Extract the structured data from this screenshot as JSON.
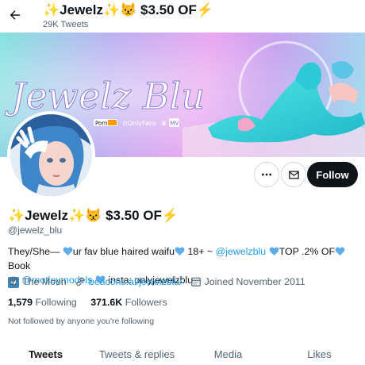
{
  "header": {
    "display_name": "✨Jewelz✨😾 $3.50 OF⚡",
    "tweet_count": "29K Tweets"
  },
  "banner": {
    "title_text": "Jewelz Blu",
    "badges": [
      "Pornhub",
      "OnlyFans",
      "ManyVids"
    ]
  },
  "actions": {
    "follow_label": "Follow"
  },
  "profile": {
    "display_name": "✨Jewelz✨😾 $3.50 OF⚡",
    "handle": "@jewelz_blu",
    "bio": {
      "p1": "They/She— ",
      "p2": "ur fav blue haired waifu",
      "p3": " 18+ ~ ",
      "mention1": "@jewelzblu",
      "p4": "TOP .2% OF",
      "p5": "Book",
      "mention2": "@motleymodels",
      "p6": " insta: onlyjewelzblu"
    },
    "location": "The Moon",
    "website": "beacons.ai/jewelzblu/",
    "joined": "Joined November 2011",
    "following_count": "1,579",
    "following_label": "Following",
    "followers_count": "371.6K",
    "followers_label": "Followers",
    "not_followed": "Not followed by anyone you're following"
  },
  "tabs": [
    {
      "label": "Tweets",
      "active": true
    },
    {
      "label": "Tweets & replies",
      "active": false
    },
    {
      "label": "Media",
      "active": false
    },
    {
      "label": "Likes",
      "active": false
    }
  ],
  "colors": {
    "accent": "#1d9bf0",
    "text": "#0f1419",
    "muted": "#536471",
    "heart": "#5dadec"
  }
}
